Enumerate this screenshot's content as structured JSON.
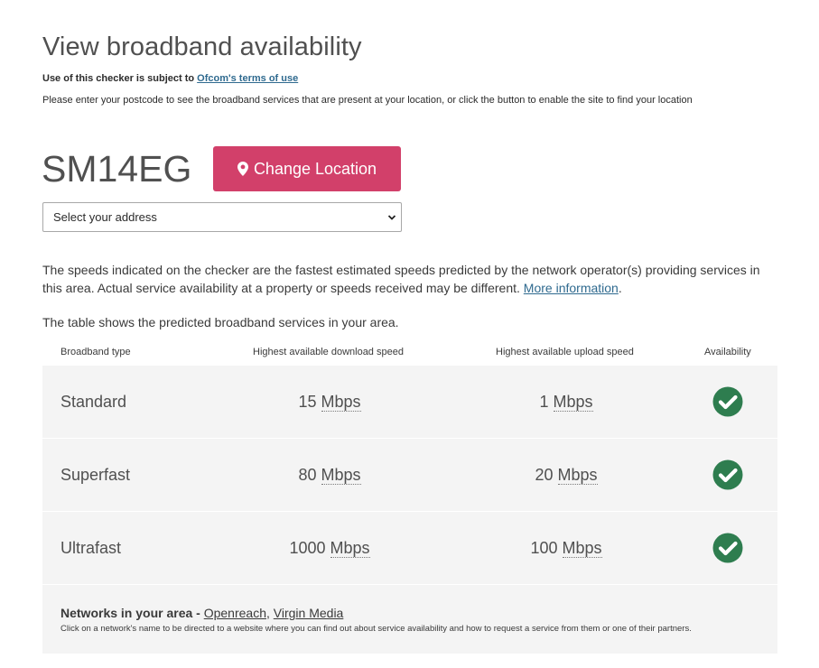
{
  "header": {
    "title": "View broadband availability",
    "terms_prefix": "Use of this checker is subject to ",
    "terms_link": "Ofcom's terms of use",
    "intro": "Please enter your postcode to see the broadband services that are present at your location, or click the button to enable the site to find your location"
  },
  "location": {
    "postcode": "SM14EG",
    "change_button_label": "Change Location",
    "change_button_icon": "map-marker-icon",
    "address_select_value": "Select your address"
  },
  "disclaimer": {
    "text": "The speeds indicated on the checker are the fastest estimated speeds predicted by the network operator(s) providing services in this area. Actual service availability at a property or speeds received may be different. ",
    "link": "More information",
    "suffix": "."
  },
  "table": {
    "intro": "The table shows the predicted broadband services in your area.",
    "headers": {
      "type": "Broadband type",
      "download": "Highest available download speed",
      "upload": "Highest available upload speed",
      "availability": "Availability"
    },
    "rows": [
      {
        "type": "Standard",
        "download_value": "15",
        "upload_value": "1",
        "unit": "Mbps",
        "available": true
      },
      {
        "type": "Superfast",
        "download_value": "80",
        "upload_value": "20",
        "unit": "Mbps",
        "available": true
      },
      {
        "type": "Ultrafast",
        "download_value": "1000",
        "upload_value": "100",
        "unit": "Mbps",
        "available": true
      }
    ],
    "check_icon": "check-circle-icon",
    "check_color": "#2e7d4f"
  },
  "networks": {
    "label": "Networks in your area - ",
    "links": [
      "Openreach",
      "Virgin Media"
    ],
    "separator": ", ",
    "note": "Click on a network's name to be directed to a website where you can find out about service availability and how to request a service from them or one of their partners."
  },
  "colors": {
    "accent_button": "#d2406a",
    "link": "#2f6a8f",
    "table_bg": "#f4f4f4"
  }
}
